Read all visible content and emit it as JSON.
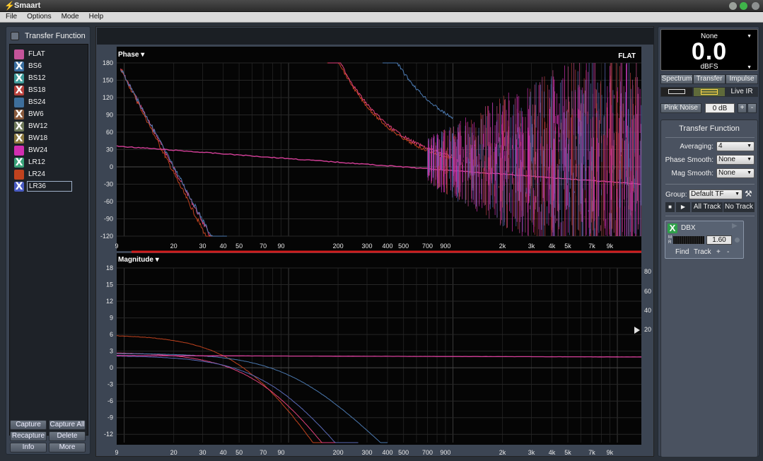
{
  "window": {
    "title": "Smaart"
  },
  "menu": [
    "File",
    "Options",
    "Mode",
    "Help"
  ],
  "left": {
    "header": "Transfer Function",
    "tracks": [
      {
        "name": "FLAT",
        "mark": "",
        "color": "#c4549a"
      },
      {
        "name": "BS6",
        "mark": "X",
        "color": "#3a6fa0"
      },
      {
        "name": "BS12",
        "mark": "X",
        "color": "#3f9c9a"
      },
      {
        "name": "BS18",
        "mark": "X",
        "color": "#b8413c"
      },
      {
        "name": "BS24",
        "mark": "",
        "color": "#3e6f9c"
      },
      {
        "name": "BW6",
        "mark": "X",
        "color": "#8a5a3c"
      },
      {
        "name": "BW12",
        "mark": "X",
        "color": "#6f7a5a"
      },
      {
        "name": "BW18",
        "mark": "X",
        "color": "#8c7a40"
      },
      {
        "name": "BW24",
        "mark": "",
        "color": "#d12eb0"
      },
      {
        "name": "LR12",
        "mark": "X",
        "color": "#3aa37a"
      },
      {
        "name": "LR24",
        "mark": "",
        "color": "#c0421e"
      },
      {
        "name": "LR36",
        "mark": "X",
        "color": "#4a5cc4"
      }
    ],
    "buttons": [
      "Capture",
      "Capture All",
      "Recapture",
      "Delete",
      "Info",
      "More"
    ]
  },
  "phase": {
    "title": "Phase ▾",
    "badge": "FLAT",
    "yticks": [
      "180",
      "150",
      "120",
      "90",
      "60",
      "30",
      "0",
      "-30",
      "-60",
      "-90",
      "-120"
    ],
    "xticks": [
      "9",
      "20",
      "30",
      "40",
      "50",
      "70",
      "90",
      "200",
      "300",
      "400",
      "500",
      "700",
      "900",
      "2k",
      "3k",
      "4k",
      "5k",
      "7k",
      "9k"
    ]
  },
  "magnitude": {
    "title": "Magnitude ▾",
    "yticks": [
      "18",
      "15",
      "12",
      "9",
      "6",
      "3",
      "0",
      "-3",
      "-6",
      "-9",
      "-12"
    ],
    "coh_ticks": [
      "80",
      "60",
      "40",
      "20"
    ],
    "xticks": [
      "9",
      "20",
      "30",
      "40",
      "50",
      "70",
      "90",
      "200",
      "300",
      "400",
      "500",
      "700",
      "900",
      "2k",
      "3k",
      "4k",
      "5k",
      "7k",
      "9k"
    ]
  },
  "meter": {
    "source": "None",
    "value": "0.0",
    "unit": "dBFS"
  },
  "modes": {
    "spectrum": "Spectrum",
    "transfer": "Transfer",
    "impulse": "Impulse",
    "live_ir": "Live IR"
  },
  "generator": {
    "label": "Pink Noise",
    "level": "0 dB",
    "plus": "+",
    "minus": "-"
  },
  "tf": {
    "title": "Transfer Function",
    "averaging_label": "Averaging:",
    "averaging": "4",
    "phase_smooth_label": "Phase Smooth:",
    "phase_smooth": "None",
    "mag_smooth_label": "Mag Smooth:",
    "mag_smooth": "None",
    "group_label": "Group:",
    "group": "Default TF",
    "all_track": "All Track",
    "no_track": "No Track",
    "device": {
      "name": "DBX",
      "m": "M",
      "r": "R",
      "delay": "1.60",
      "find": "Find",
      "track": "Track",
      "plus": "+",
      "minus": "-"
    }
  }
}
